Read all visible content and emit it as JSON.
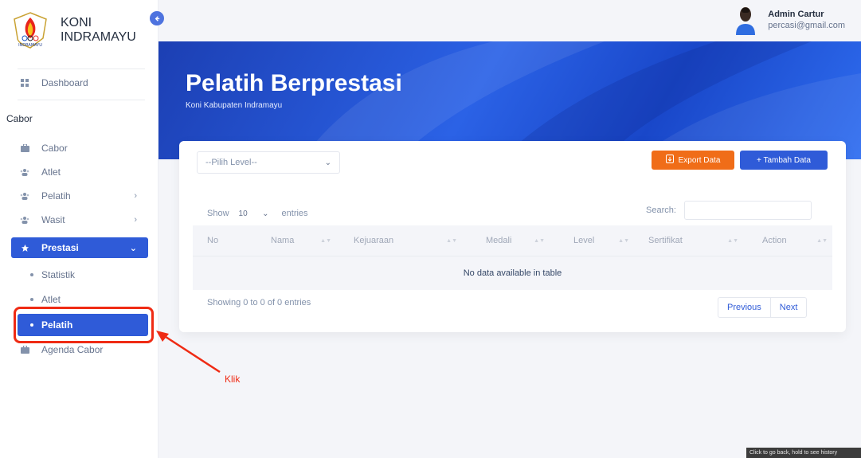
{
  "brand": {
    "line1": "KONI",
    "line2": "INDRAMAYU",
    "logo_text": "INDRAMAYU"
  },
  "sidebar": {
    "dashboard": {
      "label": "Dashboard",
      "icon": "grid-icon"
    },
    "section_title": "Cabor",
    "items": [
      {
        "label": "Cabor",
        "icon": "briefcase-icon",
        "chevron": ""
      },
      {
        "label": "Atlet",
        "icon": "users-icon",
        "chevron": ""
      },
      {
        "label": "Pelatih",
        "icon": "users-icon",
        "chevron": "›"
      },
      {
        "label": "Wasit",
        "icon": "users-icon",
        "chevron": "›"
      },
      {
        "label": "Prestasi",
        "icon": "star-icon",
        "chevron": "⌄",
        "active": true
      }
    ],
    "sub_items": [
      {
        "label": "Statistik"
      },
      {
        "label": "Atlet"
      },
      {
        "label": "Pelatih",
        "active": true
      }
    ],
    "agenda": {
      "label": "Agenda Cabor",
      "icon": "briefcase-icon"
    }
  },
  "user": {
    "name": "Admin Cartur",
    "email": "percasi@gmail.com"
  },
  "hero": {
    "title": "Pelatih Berprestasi",
    "subtitle": "Koni Kabupaten Indramayu"
  },
  "toolbar": {
    "level_placeholder": "--Pilih Level--",
    "export_label": "Export Data",
    "add_label": "+ Tambah Data"
  },
  "table_controls": {
    "show_label": "Show",
    "entries_value": "10",
    "entries_label": "entries",
    "search_label": "Search:"
  },
  "table": {
    "columns": [
      "No",
      "Nama",
      "Kejuaraan",
      "Medali",
      "Level",
      "Sertifikat",
      "Action"
    ],
    "empty_message": "No data available in table"
  },
  "footer": {
    "info": "Showing 0 to 0 of 0 entries",
    "previous": "Previous",
    "next": "Next"
  },
  "annotation": {
    "label": "Klik",
    "color": "#ef2b14"
  },
  "browser_tooltip": "Click to go back, hold to see history",
  "colors": {
    "primary": "#2f5bd8",
    "export": "#f06d18",
    "annotation": "#ef2b14"
  }
}
